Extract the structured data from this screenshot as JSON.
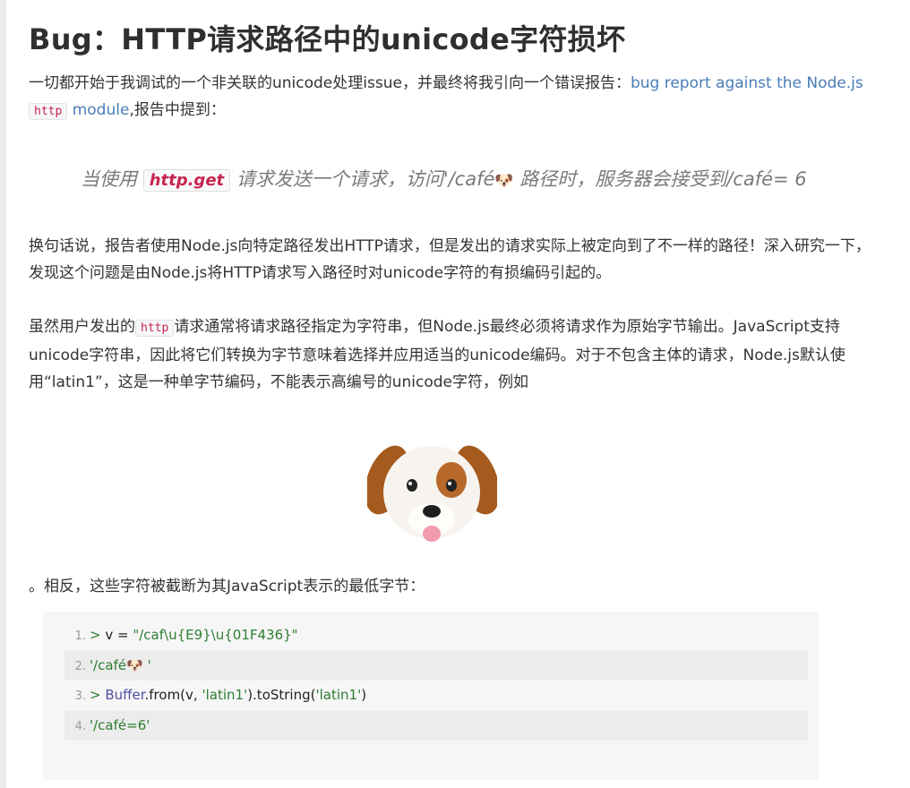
{
  "article": {
    "title": "Bug：HTTP请求路径中的unicode字符损坏",
    "p1": {
      "before": "一切都开始于我调试的一个非关联的unicode处理issue，并最终将我引向一个错误报告：",
      "link_a": "bug report against the Node.js ",
      "code": "http",
      "link_b": " module",
      "after": ",报告中提到："
    },
    "quote": {
      "before": "当使用 ",
      "code": "http.get",
      "middle": " 请求发送一个请求，访问'/café",
      "dog": "🐶",
      "after": " 路径时，服务器会接受到/café= 6"
    },
    "p2": "换句话说，报告者使用Node.js向特定路径发出HTTP请求，但是发出的请求实际上被定向到了不一样的路径！深入研究一下，发现这个问题是由Node.js将HTTP请求写入路径时对unicode字符的有损编码引起的。",
    "p3": {
      "before": "虽然用户发出的",
      "code": "http",
      "after": "请求通常将请求路径指定为字符串，但Node.js最终必须将请求作为原始字节输出。JavaScript支持unicode字符串，因此将它们转换为字节意味着选择并应用适当的unicode编码。对于不包含主体的请求，Node.js默认使用“latin1”，这是一种单字节编码，不能表示高编号的unicode字符，例如"
    },
    "p4": "。相反，这些字符被截断为其JavaScript表示的最低字节：",
    "code_lines": [
      {
        "num": "1.",
        "prompt": "> ",
        "var": "v",
        "op": " = ",
        "str": "\"/caf\\u{E9}\\u{01F436}\""
      },
      {
        "num": "2.",
        "str": "'/café🐶 '"
      },
      {
        "num": "3.",
        "prompt": "> ",
        "obj": "Buffer",
        "plain1": ".from(",
        "var": "v",
        "plain2": ", ",
        "str1": "'latin1'",
        "plain3": ").toString(",
        "str2": "'latin1'",
        "plain4": ")"
      },
      {
        "num": "4.",
        "str": "'/café=6'"
      }
    ]
  }
}
